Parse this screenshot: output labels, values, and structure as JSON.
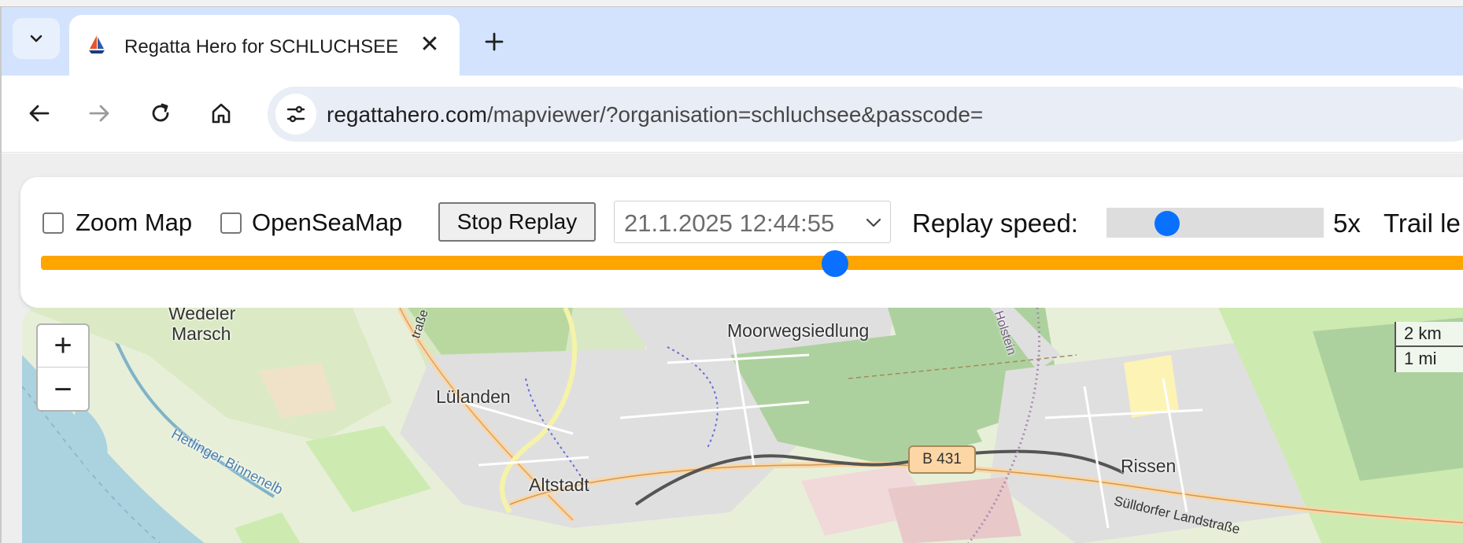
{
  "browser": {
    "tab": {
      "title": "Regatta Hero for SCHLUCHSEE",
      "favicon": "sailboat-icon",
      "close_glyph": "✕"
    },
    "new_tab_icon": "plus-icon",
    "tab_list_icon": "chevron-down-icon",
    "nav": {
      "back_icon": "arrow-left-icon",
      "forward_icon": "arrow-right-icon",
      "reload_icon": "reload-icon",
      "home_icon": "home-icon"
    },
    "omnibox": {
      "site_info_icon": "tune-icon",
      "url_host": "regattahero.com",
      "url_path": "/mapviewer/?organisation=schluchsee&passcode="
    }
  },
  "controls": {
    "zoom_map": {
      "label": "Zoom Map",
      "checked": false
    },
    "open_sea_map": {
      "label": "OpenSeaMap",
      "checked": false
    },
    "stop_replay_label": "Stop Replay",
    "datetime_select": {
      "value": "21.1.2025 12:44:55"
    },
    "replay_speed": {
      "label": "Replay speed:",
      "value_text": "5x",
      "slider_fraction": 0.28
    },
    "trail_label": "Trail le",
    "timeline": {
      "fraction": 0.55
    }
  },
  "map": {
    "zoom_in": "+",
    "zoom_out": "−",
    "scale_km": "2 km",
    "scale_mi": "1 mi",
    "labels": {
      "wedeler_marsch_1": "Wedeler",
      "wedeler_marsch_2": "Marsch",
      "moorwegsiedlung": "Moorwegsiedlung",
      "lulanden": "Lülanden",
      "altstadt": "Altstadt",
      "rissen": "Rissen",
      "b431": "B 431",
      "sulldorfer": "Sülldorfer Landstraße",
      "hetlinger": "Hetlinger Binnenelb",
      "strasse": "traße",
      "holstein": "Holstein"
    },
    "colors": {
      "water": "#aad3df",
      "park": "#cdebb0",
      "forest": "#add19e",
      "residential": "#e0dfdf",
      "road_primary": "#fcd6a4",
      "railway": "#555555"
    }
  }
}
